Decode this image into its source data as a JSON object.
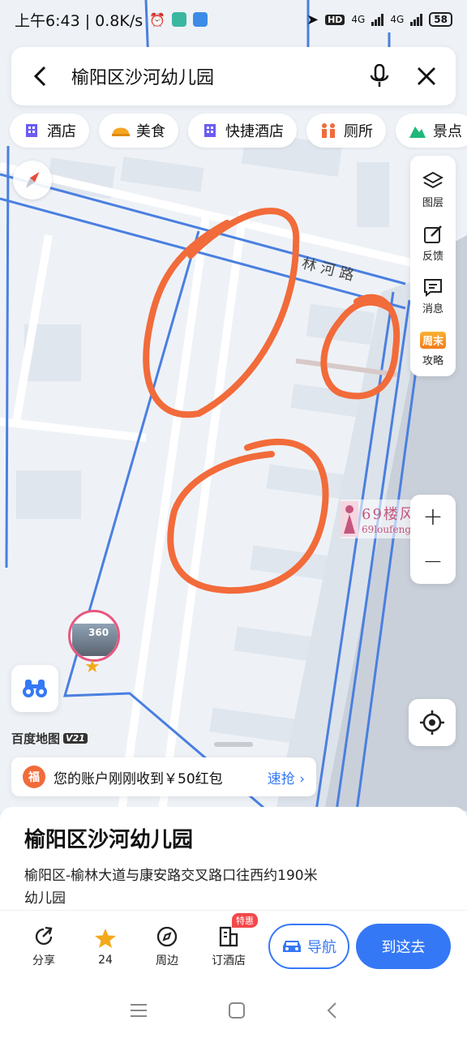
{
  "status_bar": {
    "time_text": "上午6:43 | 0.8K/s",
    "hd_label": "HD",
    "network_label_1": "4G",
    "network_label_2": "4G",
    "battery": "58"
  },
  "search": {
    "query": "榆阳区沙河幼儿园"
  },
  "chips": [
    {
      "label": "酒店",
      "icon": "hotel-icon"
    },
    {
      "label": "美食",
      "icon": "food-icon"
    },
    {
      "label": "快捷酒店",
      "icon": "express-hotel-icon"
    },
    {
      "label": "厕所",
      "icon": "toilet-icon"
    },
    {
      "label": "景点",
      "icon": "scenic-icon"
    }
  ],
  "tools": [
    {
      "label": "图层",
      "icon": "layers-icon"
    },
    {
      "label": "反馈",
      "icon": "feedback-icon"
    },
    {
      "label": "消息",
      "icon": "message-icon"
    },
    {
      "label": "攻略",
      "icon": "guide-icon",
      "badge": "周末"
    }
  ],
  "map": {
    "road_label": "林 河 路",
    "logo": "百度地图",
    "logo_version": "V21",
    "watermark_1": "69楼风",
    "watermark_2": "69loufeng.com",
    "pin_label": "360"
  },
  "promo": {
    "icon_text": "福",
    "text": "您的账户刚刚收到￥50红包",
    "link": "速抢 ›"
  },
  "poi": {
    "name": "榆阳区沙河幼儿园",
    "address": "榆阳区-榆林大道与康安路交叉路口往西约190米",
    "category": "幼儿园"
  },
  "actions": [
    {
      "label": "分享",
      "icon": "share-icon"
    },
    {
      "label": "24",
      "icon": "star-icon"
    },
    {
      "label": "周边",
      "icon": "compass-icon"
    },
    {
      "label": "订酒店",
      "icon": "hotel-book-icon",
      "badge": "特惠"
    }
  ],
  "nav_button": "导航",
  "go_button": "到这去",
  "colors": {
    "accent": "#3578f6",
    "annotation": "#f26b3a",
    "boundary": "#4a7fe0"
  }
}
